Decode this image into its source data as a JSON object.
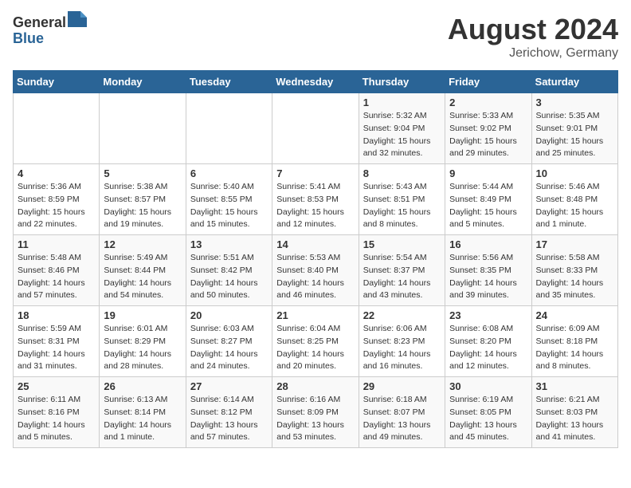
{
  "header": {
    "logo_line1": "General",
    "logo_line2": "Blue",
    "month_year": "August 2024",
    "location": "Jerichow, Germany"
  },
  "days_of_week": [
    "Sunday",
    "Monday",
    "Tuesday",
    "Wednesday",
    "Thursday",
    "Friday",
    "Saturday"
  ],
  "weeks": [
    [
      {
        "num": "",
        "info": ""
      },
      {
        "num": "",
        "info": ""
      },
      {
        "num": "",
        "info": ""
      },
      {
        "num": "",
        "info": ""
      },
      {
        "num": "1",
        "info": "Sunrise: 5:32 AM\nSunset: 9:04 PM\nDaylight: 15 hours\nand 32 minutes."
      },
      {
        "num": "2",
        "info": "Sunrise: 5:33 AM\nSunset: 9:02 PM\nDaylight: 15 hours\nand 29 minutes."
      },
      {
        "num": "3",
        "info": "Sunrise: 5:35 AM\nSunset: 9:01 PM\nDaylight: 15 hours\nand 25 minutes."
      }
    ],
    [
      {
        "num": "4",
        "info": "Sunrise: 5:36 AM\nSunset: 8:59 PM\nDaylight: 15 hours\nand 22 minutes."
      },
      {
        "num": "5",
        "info": "Sunrise: 5:38 AM\nSunset: 8:57 PM\nDaylight: 15 hours\nand 19 minutes."
      },
      {
        "num": "6",
        "info": "Sunrise: 5:40 AM\nSunset: 8:55 PM\nDaylight: 15 hours\nand 15 minutes."
      },
      {
        "num": "7",
        "info": "Sunrise: 5:41 AM\nSunset: 8:53 PM\nDaylight: 15 hours\nand 12 minutes."
      },
      {
        "num": "8",
        "info": "Sunrise: 5:43 AM\nSunset: 8:51 PM\nDaylight: 15 hours\nand 8 minutes."
      },
      {
        "num": "9",
        "info": "Sunrise: 5:44 AM\nSunset: 8:49 PM\nDaylight: 15 hours\nand 5 minutes."
      },
      {
        "num": "10",
        "info": "Sunrise: 5:46 AM\nSunset: 8:48 PM\nDaylight: 15 hours\nand 1 minute."
      }
    ],
    [
      {
        "num": "11",
        "info": "Sunrise: 5:48 AM\nSunset: 8:46 PM\nDaylight: 14 hours\nand 57 minutes."
      },
      {
        "num": "12",
        "info": "Sunrise: 5:49 AM\nSunset: 8:44 PM\nDaylight: 14 hours\nand 54 minutes."
      },
      {
        "num": "13",
        "info": "Sunrise: 5:51 AM\nSunset: 8:42 PM\nDaylight: 14 hours\nand 50 minutes."
      },
      {
        "num": "14",
        "info": "Sunrise: 5:53 AM\nSunset: 8:40 PM\nDaylight: 14 hours\nand 46 minutes."
      },
      {
        "num": "15",
        "info": "Sunrise: 5:54 AM\nSunset: 8:37 PM\nDaylight: 14 hours\nand 43 minutes."
      },
      {
        "num": "16",
        "info": "Sunrise: 5:56 AM\nSunset: 8:35 PM\nDaylight: 14 hours\nand 39 minutes."
      },
      {
        "num": "17",
        "info": "Sunrise: 5:58 AM\nSunset: 8:33 PM\nDaylight: 14 hours\nand 35 minutes."
      }
    ],
    [
      {
        "num": "18",
        "info": "Sunrise: 5:59 AM\nSunset: 8:31 PM\nDaylight: 14 hours\nand 31 minutes."
      },
      {
        "num": "19",
        "info": "Sunrise: 6:01 AM\nSunset: 8:29 PM\nDaylight: 14 hours\nand 28 minutes."
      },
      {
        "num": "20",
        "info": "Sunrise: 6:03 AM\nSunset: 8:27 PM\nDaylight: 14 hours\nand 24 minutes."
      },
      {
        "num": "21",
        "info": "Sunrise: 6:04 AM\nSunset: 8:25 PM\nDaylight: 14 hours\nand 20 minutes."
      },
      {
        "num": "22",
        "info": "Sunrise: 6:06 AM\nSunset: 8:23 PM\nDaylight: 14 hours\nand 16 minutes."
      },
      {
        "num": "23",
        "info": "Sunrise: 6:08 AM\nSunset: 8:20 PM\nDaylight: 14 hours\nand 12 minutes."
      },
      {
        "num": "24",
        "info": "Sunrise: 6:09 AM\nSunset: 8:18 PM\nDaylight: 14 hours\nand 8 minutes."
      }
    ],
    [
      {
        "num": "25",
        "info": "Sunrise: 6:11 AM\nSunset: 8:16 PM\nDaylight: 14 hours\nand 5 minutes."
      },
      {
        "num": "26",
        "info": "Sunrise: 6:13 AM\nSunset: 8:14 PM\nDaylight: 14 hours\nand 1 minute."
      },
      {
        "num": "27",
        "info": "Sunrise: 6:14 AM\nSunset: 8:12 PM\nDaylight: 13 hours\nand 57 minutes."
      },
      {
        "num": "28",
        "info": "Sunrise: 6:16 AM\nSunset: 8:09 PM\nDaylight: 13 hours\nand 53 minutes."
      },
      {
        "num": "29",
        "info": "Sunrise: 6:18 AM\nSunset: 8:07 PM\nDaylight: 13 hours\nand 49 minutes."
      },
      {
        "num": "30",
        "info": "Sunrise: 6:19 AM\nSunset: 8:05 PM\nDaylight: 13 hours\nand 45 minutes."
      },
      {
        "num": "31",
        "info": "Sunrise: 6:21 AM\nSunset: 8:03 PM\nDaylight: 13 hours\nand 41 minutes."
      }
    ]
  ]
}
